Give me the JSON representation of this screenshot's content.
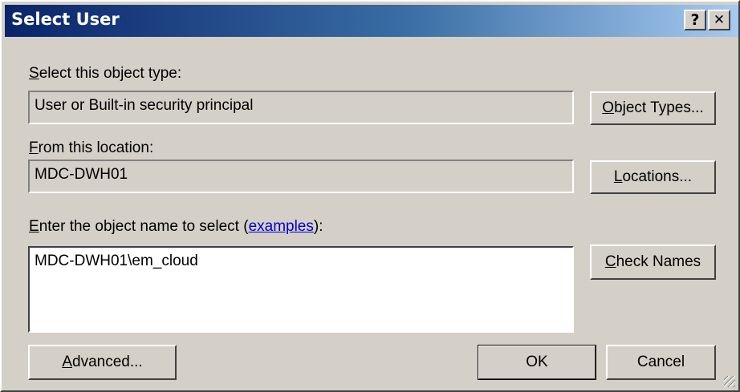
{
  "window": {
    "title": "Select User",
    "help_glyph": "?",
    "close_glyph": "✕"
  },
  "object_type": {
    "label_key": "S",
    "label_rest": "elect this object type:",
    "value": "User or Built-in security principal",
    "button_key": "O",
    "button_rest": "bject Types..."
  },
  "location": {
    "label_key": "F",
    "label_rest": "rom this location:",
    "value": "MDC-DWH01",
    "button_key": "L",
    "button_rest": "ocations..."
  },
  "names": {
    "label_key": "E",
    "label_rest": "nter the object name to select (",
    "link_text": "examples",
    "label_end": "):",
    "value": "MDC-DWH01\\em_cloud",
    "button_key": "C",
    "button_rest": "heck Names"
  },
  "footer": {
    "advanced_key": "A",
    "advanced_rest": "dvanced...",
    "ok_label": "OK",
    "cancel_label": "Cancel"
  }
}
